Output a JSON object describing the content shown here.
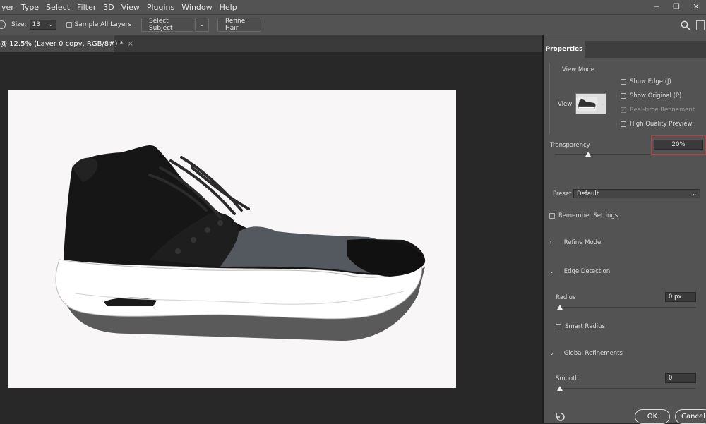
{
  "menu": [
    "yer",
    "Type",
    "Select",
    "Filter",
    "3D",
    "View",
    "Plugins",
    "Window",
    "Help"
  ],
  "window_controls": [
    "─",
    "❐",
    "✕"
  ],
  "options": {
    "size_label": "Size:",
    "size_value": "13",
    "sample_all_layers": "Sample All Layers",
    "select_subject": "Select Subject",
    "refine_hair": "Refine Hair"
  },
  "document_tab": {
    "title": "@ 12.5% (Layer 0 copy, RGB/8#) *",
    "close": "×"
  },
  "panel": {
    "tab": "Properties",
    "view_mode": {
      "title": "View Mode",
      "view_label": "View",
      "show_edge": "Show Edge (J)",
      "show_original": "Show Original (P)",
      "realtime_refinement": "Real-time Refinement",
      "high_quality_preview": "High Quality Preview",
      "realtime_checked": true
    },
    "transparency": {
      "label": "Transparency",
      "value": "20%",
      "fraction": 0.2
    },
    "preset": {
      "label": "Preset",
      "value": "Default"
    },
    "remember_settings": "Remember Settings",
    "refine_mode": "Refine Mode",
    "edge_detection": {
      "title": "Edge Detection",
      "radius_label": "Radius",
      "radius_value": "0 px",
      "smart_radius": "Smart Radius"
    },
    "global_refinements": {
      "title": "Global Refinements",
      "smooth_label": "Smooth",
      "smooth_value": "0"
    },
    "ok": "OK",
    "cancel": "Cancel"
  },
  "colors": {
    "accent_highlight": "#c8373a",
    "panel_bg": "#535353",
    "canvas_bg": "#282828"
  }
}
